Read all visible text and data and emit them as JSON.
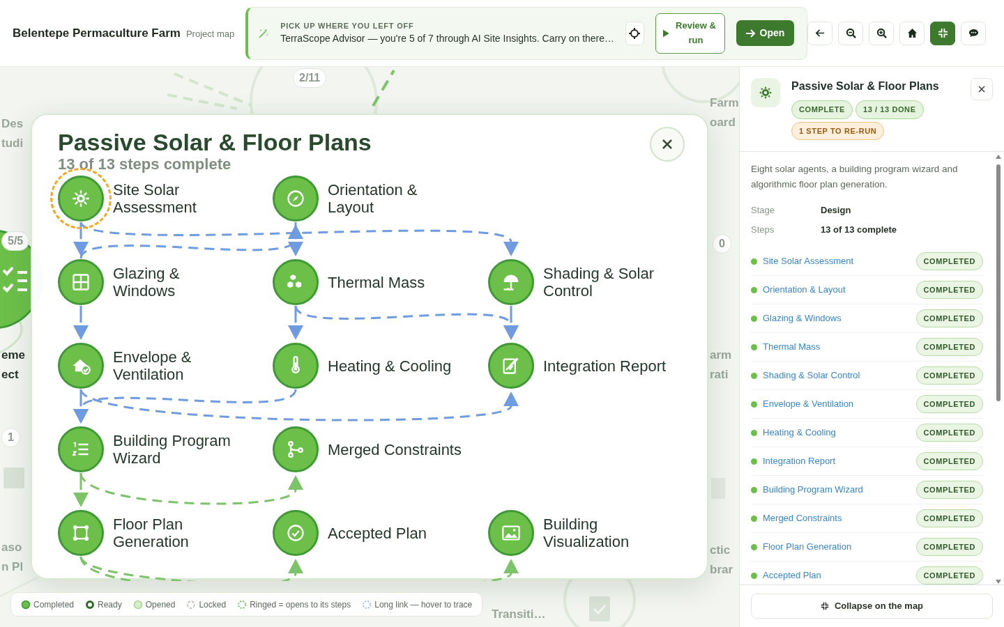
{
  "project": {
    "name": "Belentepe Permaculture Farm",
    "subtitle": "Project map"
  },
  "resume": {
    "overline": "PICK UP WHERE YOU LEFT OFF",
    "message": "TerraScope Advisor — you're 5 of 7 through AI Site Insights. Carry on there…",
    "actions": [
      {
        "label": "Review & run",
        "kind": "outline"
      },
      {
        "label": "Open",
        "kind": "primary"
      }
    ]
  },
  "toolbar": [
    {
      "kind": "back",
      "selected": false
    },
    {
      "kind": "zoom-out",
      "selected": false
    },
    {
      "kind": "zoom-in",
      "selected": false
    },
    {
      "kind": "home",
      "selected": false
    },
    {
      "kind": "collapse",
      "selected": true
    },
    {
      "kind": "chat",
      "selected": false
    }
  ],
  "map": {
    "labels": [
      {
        "lines": [
          "Des",
          "tudi"
        ],
        "dim": true
      },
      {
        "lines": [
          "eme",
          "ect"
        ],
        "dim": false
      },
      {
        "lines": [
          "aso",
          "n Pl"
        ],
        "dim": true
      },
      {
        "lines": [
          "Farm",
          "oard"
        ],
        "dim": true
      },
      {
        "lines": [
          "arm",
          "rati"
        ],
        "dim": true
      },
      {
        "lines": [
          "ctic",
          "brar"
        ],
        "dim": true
      },
      {
        "lines": [
          "Transiti…"
        ],
        "dim": true
      }
    ],
    "counts": [
      "5/5",
      "2/11",
      "0",
      "1"
    ]
  },
  "modal": {
    "title": "Passive Solar & Floor Plans",
    "subtitle": "13 of 13 steps complete",
    "rows": [
      {
        "steps": [
          {
            "label": "Site Solar Assessment",
            "done": true,
            "ringed": true
          },
          {
            "label": "Orientation & Layout",
            "done": true,
            "ringed": false
          }
        ]
      },
      {
        "steps": [
          {
            "label": "Glazing & Windows",
            "done": true,
            "ringed": false
          },
          {
            "label": "Thermal Mass",
            "done": true,
            "ringed": false
          },
          {
            "label": "Shading & Solar Control",
            "done": true,
            "ringed": false
          }
        ]
      },
      {
        "steps": [
          {
            "label": "Envelope & Ventilation",
            "done": true,
            "ringed": false
          },
          {
            "label": "Heating & Cooling",
            "done": true,
            "ringed": false
          },
          {
            "label": "Integration Report",
            "done": true,
            "ringed": false
          }
        ]
      },
      {
        "steps": [
          {
            "label": "Building Program Wizard",
            "done": true,
            "ringed": false
          },
          {
            "label": "Merged Constraints",
            "done": true,
            "ringed": false
          }
        ]
      },
      {
        "steps": [
          {
            "label": "Floor Plan Generation",
            "done": true,
            "ringed": false
          },
          {
            "label": "Accepted Plan",
            "done": true,
            "ringed": false
          },
          {
            "label": "Building Visualization",
            "done": true,
            "ringed": false
          }
        ]
      }
    ],
    "links": [
      {
        "kind": "long"
      },
      {
        "kind": "long"
      },
      {
        "kind": "long"
      },
      {
        "kind": "long"
      },
      {
        "kind": "long"
      },
      {
        "kind": "long"
      },
      {
        "kind": "long"
      },
      {
        "kind": "long"
      },
      {
        "kind": "long"
      },
      {
        "kind": "long"
      },
      {
        "kind": "long"
      },
      {
        "kind": "short"
      },
      {
        "kind": "short"
      },
      {
        "kind": "short"
      },
      {
        "kind": "short"
      }
    ]
  },
  "panel": {
    "title": "Passive Solar & Floor Plans",
    "badges": [
      {
        "label": "COMPLETE",
        "warning": false
      },
      {
        "label": "13 / 13 DONE",
        "warning": false
      },
      {
        "label": "1 STEP TO RE-RUN",
        "warning": true
      }
    ],
    "description": "Eight solar agents, a building program wizard and algorithmic floor plan generation.",
    "facts": [
      {
        "label": "Stage",
        "value": "Design"
      },
      {
        "label": "Steps",
        "value": "13 of 13 complete"
      }
    ],
    "steps": [
      {
        "label": "Site Solar Assessment",
        "status": "COMPLETED",
        "done": true
      },
      {
        "label": "Orientation & Layout",
        "status": "COMPLETED",
        "done": true
      },
      {
        "label": "Glazing & Windows",
        "status": "COMPLETED",
        "done": true
      },
      {
        "label": "Thermal Mass",
        "status": "COMPLETED",
        "done": true
      },
      {
        "label": "Shading & Solar Control",
        "status": "COMPLETED",
        "done": true
      },
      {
        "label": "Envelope & Ventilation",
        "status": "COMPLETED",
        "done": true
      },
      {
        "label": "Heating & Cooling",
        "status": "COMPLETED",
        "done": true
      },
      {
        "label": "Integration Report",
        "status": "COMPLETED",
        "done": true
      },
      {
        "label": "Building Program Wizard",
        "status": "COMPLETED",
        "done": true
      },
      {
        "label": "Merged Constraints",
        "status": "COMPLETED",
        "done": true
      },
      {
        "label": "Floor Plan Generation",
        "status": "COMPLETED",
        "done": true
      },
      {
        "label": "Accepted Plan",
        "status": "COMPLETED",
        "done": true
      }
    ],
    "footer_button": "Collapse on the map"
  },
  "legend": [
    {
      "label": "Completed",
      "kind": "completed"
    },
    {
      "label": "Ready",
      "kind": "ready"
    },
    {
      "label": "Opened",
      "kind": "opened"
    },
    {
      "label": "Locked",
      "kind": "locked"
    },
    {
      "label": "Ringed = opens to its steps",
      "kind": "ringed"
    },
    {
      "label": "Long link — hover to trace",
      "kind": "long"
    }
  ]
}
